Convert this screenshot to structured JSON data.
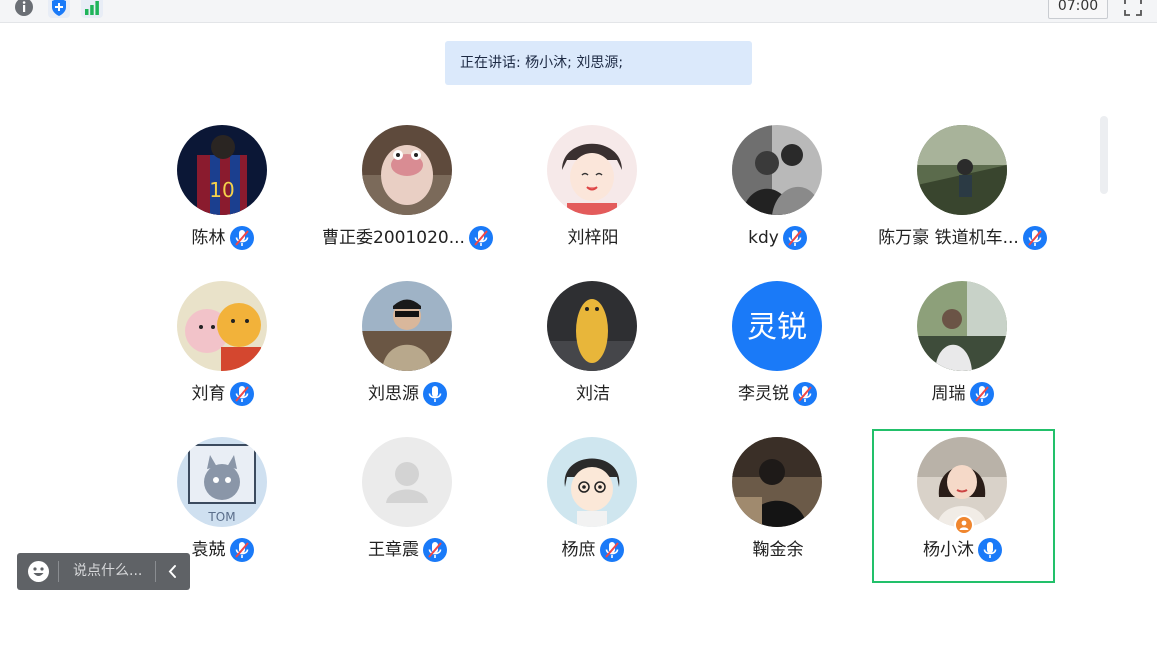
{
  "toolbar": {
    "icons": [
      "info-icon",
      "shield-icon",
      "signal-icon",
      "fullscreen-icon"
    ],
    "timer": "07:00"
  },
  "speaking": {
    "text": "正在讲话: 杨小沐; 刘思源;"
  },
  "participants": [
    {
      "name": "陈林",
      "mic": "muted"
    },
    {
      "name": "曹正委2001020...",
      "mic": "muted"
    },
    {
      "name": "刘梓阳",
      "mic": "none"
    },
    {
      "name": "kdy",
      "mic": "muted"
    },
    {
      "name": "陈万豪 铁道机车...",
      "mic": "muted"
    },
    {
      "name": "刘育",
      "mic": "muted"
    },
    {
      "name": "刘思源",
      "mic": "active"
    },
    {
      "name": "刘洁",
      "mic": "none"
    },
    {
      "name": "李灵锐",
      "mic": "muted",
      "avatar_text": "灵锐"
    },
    {
      "name": "周瑞",
      "mic": "muted"
    },
    {
      "name": "袁兢",
      "mic": "muted"
    },
    {
      "name": "王章震",
      "mic": "muted"
    },
    {
      "name": "杨庶",
      "mic": "muted"
    },
    {
      "name": "鞠金余",
      "mic": "none"
    },
    {
      "name": "杨小沐",
      "mic": "active",
      "selected": true,
      "host": true
    }
  ],
  "chat": {
    "placeholder": "说点什么..."
  },
  "colors": {
    "accent": "#1a7af8",
    "selected_border": "#22c06a",
    "host_badge": "#f0862e",
    "speaking_bg": "#dbe9fb"
  }
}
